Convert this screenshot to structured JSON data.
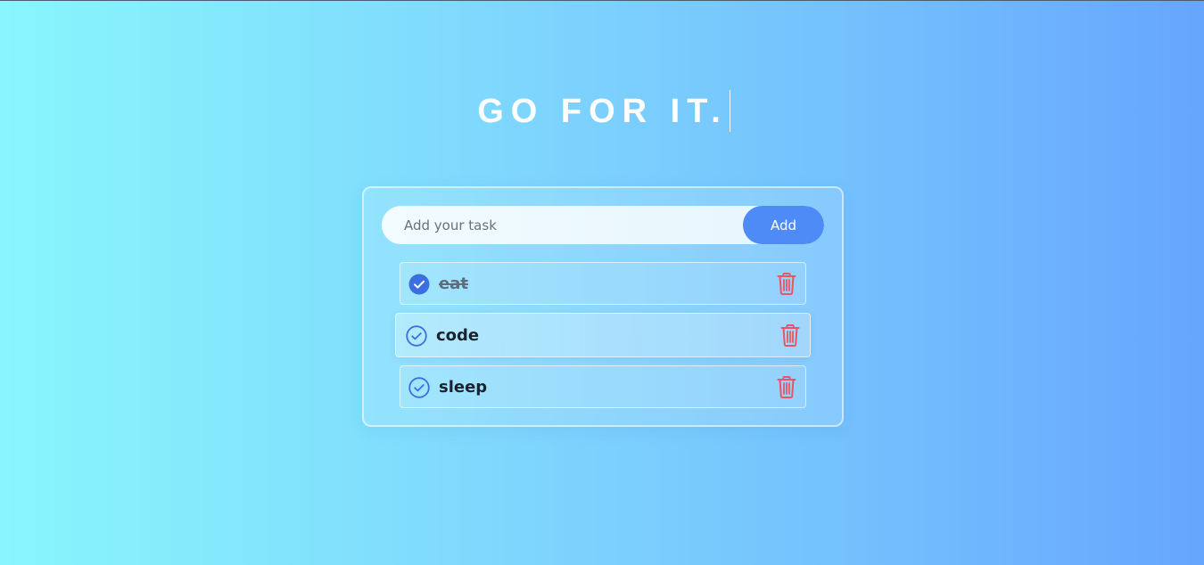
{
  "header": {
    "title": "GO FOR IT."
  },
  "form": {
    "placeholder": "Add your task",
    "add_label": "Add"
  },
  "tasks": [
    {
      "text": "eat",
      "done": true
    },
    {
      "text": "code",
      "done": false
    },
    {
      "text": "sleep",
      "done": false
    }
  ],
  "colors": {
    "accent": "#4f8bf6",
    "check": "#3b6fe0",
    "delete": "#ea5565"
  },
  "icons": {
    "check": "check-circle-icon",
    "delete": "trash-icon"
  }
}
